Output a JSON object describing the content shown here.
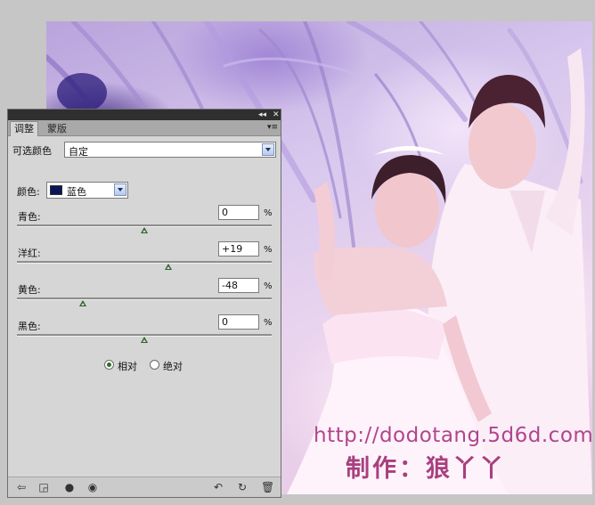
{
  "panel": {
    "tabs": [
      {
        "label": "调整",
        "active": true
      },
      {
        "label": "蒙版",
        "active": false
      }
    ],
    "title_controls": {
      "collapse": "◂◂",
      "close": "✕"
    },
    "preset_label": "可选颜色",
    "preset_value": "自定",
    "colors_label": "颜色:",
    "colors_value": "蓝色",
    "swatch_color": "#0a1656",
    "sliders": [
      {
        "label": "青色:",
        "value": "0",
        "unit": "%",
        "position": 0.5
      },
      {
        "label": "洋红:",
        "value": "+19",
        "unit": "%",
        "position": 0.595
      },
      {
        "label": "黄色:",
        "value": "-48",
        "unit": "%",
        "position": 0.26
      },
      {
        "label": "黑色:",
        "value": "0",
        "unit": "%",
        "position": 0.5
      }
    ],
    "methods": [
      {
        "label": "相对",
        "selected": true
      },
      {
        "label": "绝对",
        "selected": false
      }
    ],
    "bottom_icons": [
      "back-arrow-icon",
      "clip-layer-icon",
      "visibility-toggle-icon",
      "eye-icon",
      "previous-state-icon",
      "reset-icon",
      "trash-icon"
    ]
  },
  "canvas": {
    "watermark_url": "http://dodotang.5d6d.com",
    "watermark_credit": "制作：狼丫丫"
  }
}
